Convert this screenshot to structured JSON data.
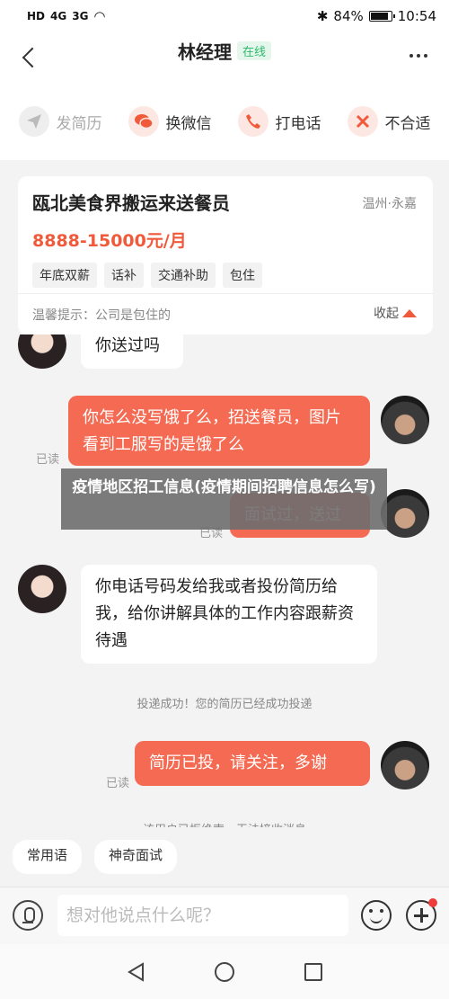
{
  "status_bar": {
    "left_chips": [
      "HD",
      "4G",
      "3G"
    ],
    "bluetooth": "✱",
    "battery_pct": "84%",
    "time": "10:54"
  },
  "header": {
    "title": "林经理",
    "online_badge": "在线"
  },
  "actions": [
    {
      "label": "发简历",
      "icon": "paper-plane-icon",
      "enabled": false
    },
    {
      "label": "换微信",
      "icon": "wechat-icon",
      "enabled": true
    },
    {
      "label": "打电话",
      "icon": "phone-icon",
      "enabled": true
    },
    {
      "label": "不合适",
      "icon": "close-icon",
      "enabled": true
    }
  ],
  "job": {
    "title": "瓯北美食界搬运来送餐员",
    "location": "温州·永嘉",
    "salary": "8888-15000元/月",
    "tags": [
      "年底双薪",
      "话补",
      "交通补助",
      "包住"
    ],
    "tip": "温馨提示：公司是包住的",
    "collapse_label": "收起"
  },
  "messages": {
    "m1": "你送过吗",
    "m2": "你怎么没写饿了么，招送餐员，图片看到工服写的是饿了么",
    "m3": "面试过，送过",
    "m4": "你电话号码发给我或者投份简历给我，给你讲解具体的工作内容跟薪资待遇",
    "m5": "简历已投，请关注，多谢",
    "read_label": "已读",
    "system_1": "投递成功！您的简历已经成功投递",
    "system_2": "该用户已拒绝索，无法接收消息"
  },
  "overlay_caption": "疫情地区招工信息(疫情期间招聘信息怎么写)",
  "quick_replies": [
    "常用语",
    "神奇面试"
  ],
  "input": {
    "placeholder": "想对他说点什么呢？"
  },
  "colors": {
    "accent": "#f46a52",
    "online": "#2fb96a",
    "salary": "#f05a3a"
  }
}
